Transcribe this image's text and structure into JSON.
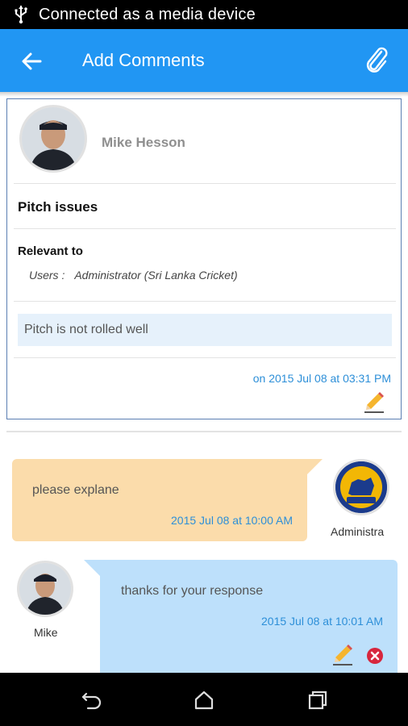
{
  "status_bar": {
    "text": "Connected as a media device"
  },
  "app_bar": {
    "title": "Add Comments"
  },
  "post": {
    "author": "Mike Hesson",
    "title": "Pitch issues",
    "relevant_label": "Relevant to",
    "users_label": "Users :",
    "users_value": "Administrator (Sri Lanka Cricket)",
    "body": "Pitch is not rolled well",
    "date": "on 2015 Jul 08 at 03:31 PM"
  },
  "comments": [
    {
      "text": "please explane",
      "date": "2015 Jul 08 at 10:00 AM",
      "author": "Administra",
      "color": "#fbdcab"
    },
    {
      "text": "thanks for your response",
      "date": "2015 Jul 08 at 10:01 AM",
      "author": "Mike",
      "color": "#bde0fb"
    }
  ],
  "colors": {
    "app_bar": "#2196F3",
    "link": "#2d8fd8"
  }
}
